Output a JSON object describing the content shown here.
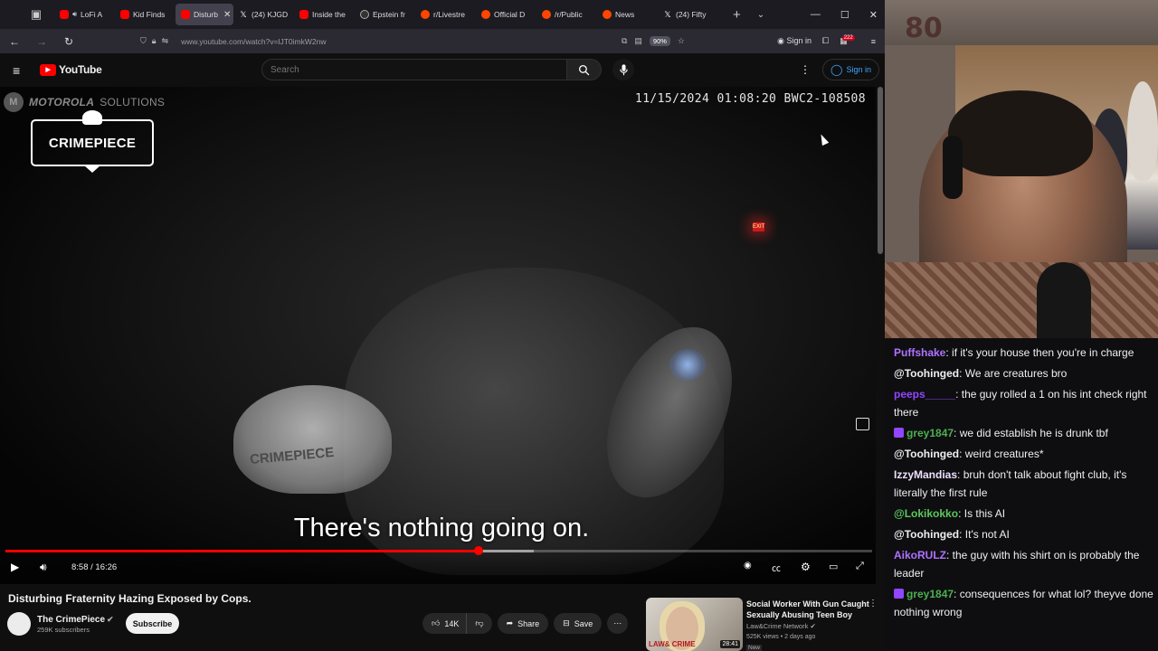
{
  "browser": {
    "tabs": [
      {
        "label": "LoFi A",
        "favicon": "youtube-icon",
        "audio": true
      },
      {
        "label": "Kid Finds",
        "favicon": "youtube-icon"
      },
      {
        "label": "Disturb",
        "favicon": "youtube-icon",
        "active": true
      },
      {
        "label": "(24) KJGD",
        "favicon": "x-icon"
      },
      {
        "label": "Inside the",
        "favicon": "youtube-icon"
      },
      {
        "label": "Epstein fr",
        "favicon": "epstein-icon"
      },
      {
        "label": "r/Livestre",
        "favicon": "reddit-icon"
      },
      {
        "label": "Official D",
        "favicon": "reddit-icon"
      },
      {
        "label": "/r/Public",
        "favicon": "reddit-icon"
      },
      {
        "label": "News",
        "favicon": "reddit-icon"
      },
      {
        "label": "(24) Fifty",
        "favicon": "x-icon"
      }
    ],
    "url": "www.youtube.com/watch?v=lJT0imkW2nw",
    "zoom": "90%",
    "signin_label": "Sign in",
    "extension_badge": "222"
  },
  "youtube": {
    "logo_text": "YouTube",
    "search_placeholder": "Search",
    "signin_label": "Sign in"
  },
  "video": {
    "overlay_brand": "MOTOROLA",
    "overlay_brand_suffix": "SOLUTIONS",
    "channel_logo": "CRIMEPIECE",
    "bodycam_stamp": "11/15/2024 01:08:20 BWC2-108508",
    "hat_text": "CRIMEPIECE",
    "exit_sign": "EXIT",
    "subtitle": "There's nothing going on.",
    "time_current": "8:58",
    "time_total": "16:26",
    "progress_fraction": 0.546,
    "buffered_fraction": 0.61
  },
  "details": {
    "title": "Disturbing Fraternity Hazing Exposed by Cops.",
    "channel_name": "The CrimePiece",
    "subscribers": "259K subscribers",
    "subscribe_label": "Subscribe",
    "likes": "14K",
    "share_label": "Share",
    "save_label": "Save"
  },
  "recommendation": {
    "title": "Social Worker With Gun Caught Sexually Abusing Teen Boy",
    "channel": "Law&Crime Network",
    "meta": "525K views • 2 days ago",
    "badge": "New",
    "duration": "28:41",
    "watermark": "LAW& CRIME"
  },
  "webcam": {
    "badge_text": "80"
  },
  "chat": [
    {
      "user": "Puffshake",
      "color": "#b072ff",
      "text": ": if it's your house then you're in charge",
      "badge": false
    },
    {
      "user": "@Toohinged",
      "color": "#efeff1",
      "text": ": We are creatures bro",
      "badge": false
    },
    {
      "user": "peeps_____",
      "color": "#9146ff",
      "text": ": the guy rolled a 1 on his int check right there",
      "badge": false
    },
    {
      "user": "grey1847",
      "color": "#4caf50",
      "text": ": we did establish he is drunk tbf",
      "badge": true
    },
    {
      "user": "@Toohinged",
      "color": "#efeff1",
      "text": ": weird creatures*",
      "badge": false
    },
    {
      "user": "IzzyMandias",
      "color": "#efe0ff",
      "text": ": bruh don't talk about fight club, it's literally the first rule",
      "badge": false
    },
    {
      "user": "@Lokikokko",
      "color": "#5cc85c",
      "text": ": Is this AI",
      "badge": false
    },
    {
      "user": "@Toohinged",
      "color": "#efeff1",
      "text": ": It's not AI",
      "badge": false
    },
    {
      "user": "AikoRULZ",
      "color": "#b072ff",
      "text": ": the guy with his shirt on is probably the leader",
      "badge": false
    },
    {
      "user": "grey1847",
      "color": "#4caf50",
      "text": ": consequences for what lol? theyve done nothing wrong",
      "badge": true
    }
  ]
}
